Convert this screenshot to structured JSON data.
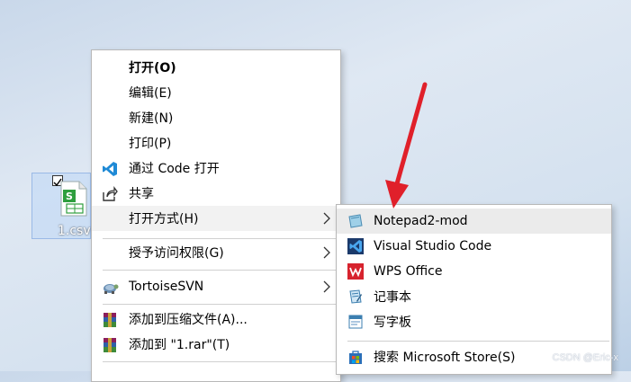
{
  "desktop": {
    "file_label": "1.csv"
  },
  "context_menu": {
    "items": [
      {
        "label": "打开(O)"
      },
      {
        "label": "编辑(E)"
      },
      {
        "label": "新建(N)"
      },
      {
        "label": "打印(P)"
      },
      {
        "label": "通过 Code 打开",
        "icon": "vscode-icon"
      },
      {
        "label": "共享",
        "icon": "share-icon"
      },
      {
        "label": "打开方式(H)"
      },
      {
        "label": "授予访问权限(G)"
      },
      {
        "label": "TortoiseSVN",
        "icon": "tortoisesvn-icon"
      },
      {
        "label": "添加到压缩文件(A)...",
        "icon": "winrar-icon"
      },
      {
        "label": "添加到 \"1.rar\"(T)",
        "icon": "winrar-icon"
      }
    ]
  },
  "open_with_submenu": {
    "items": [
      {
        "label": "Notepad2-mod",
        "icon": "notepad2-icon"
      },
      {
        "label": "Visual Studio Code",
        "icon": "vscode-icon"
      },
      {
        "label": "WPS Office",
        "icon": "wps-icon"
      },
      {
        "label": "记事本",
        "icon": "notepad-icon"
      },
      {
        "label": "写字板",
        "icon": "wordpad-icon"
      },
      {
        "label": "搜索 Microsoft Store(S)",
        "icon": "store-icon"
      }
    ]
  },
  "colors": {
    "arrow": "#e0202a",
    "vscode": "#1f8ad6",
    "wps": "#d7232e",
    "menu_hover": "#f2f2f2"
  },
  "watermark": "CSDN @Eric-x"
}
